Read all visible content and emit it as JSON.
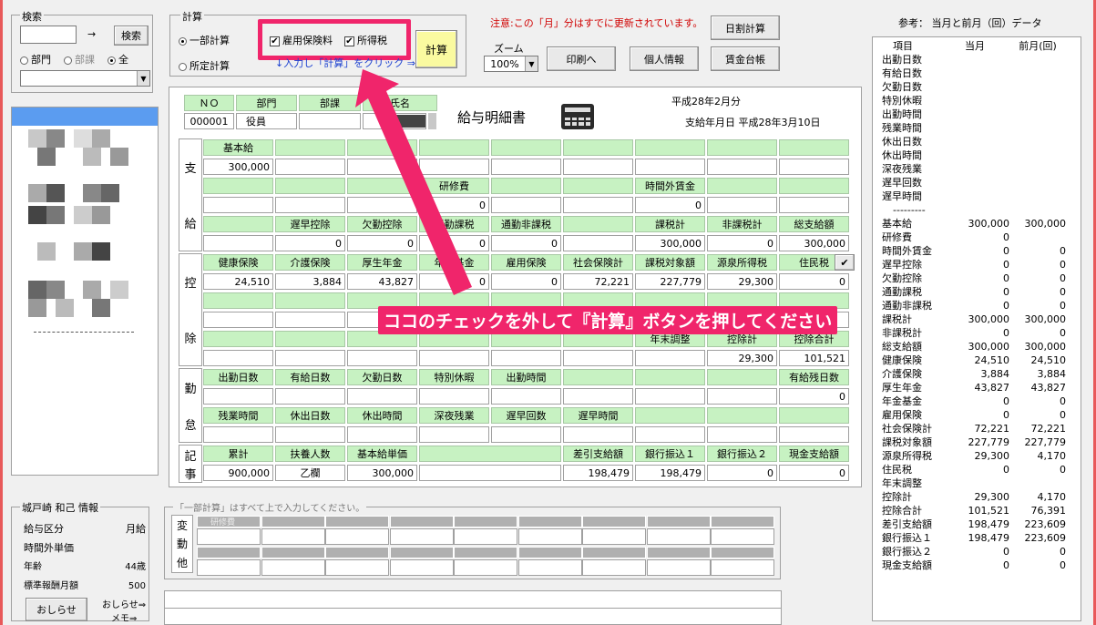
{
  "search": {
    "title": "検索",
    "value": "",
    "button": "検索",
    "arrow": "→",
    "radios": [
      "部門",
      "部課",
      "全"
    ],
    "selected": "全"
  },
  "calc": {
    "title": "計算",
    "partial_label": "一部計算",
    "fixed_label": "所定計算",
    "chk_insurance": "雇用保険料",
    "chk_tax": "所得税",
    "hint": "↓入力し「計算」をクリック ⇒",
    "calc_button": "計算"
  },
  "notice": "注意:この「月」分はすでに更新されています。",
  "zoom": {
    "label": "ズーム",
    "value": "100%"
  },
  "buttons": {
    "daily": "日割計算",
    "print": "印刷へ",
    "personal": "個人情報",
    "ledger": "賃金台帳"
  },
  "slip": {
    "no_label": "ＮＯ",
    "dept_label": "部門",
    "section_label": "部課",
    "name_label": "氏名",
    "no": "000001",
    "dept": "役員",
    "section": "",
    "name": "",
    "title": "給与明細書",
    "period": "平成28年2月分",
    "pay_date": "支給年月日 平成28年3月10日"
  },
  "shikyu": {
    "label1": "支",
    "label2": "給",
    "r1_h": [
      "基本給",
      "",
      "",
      "",
      "",
      "",
      "",
      "",
      ""
    ],
    "r1_v": [
      "300,000",
      "",
      "",
      "",
      "",
      "",
      "",
      "",
      ""
    ],
    "r2_h": [
      "",
      "",
      "",
      "研修費",
      "",
      "",
      "時間外賃金",
      "",
      ""
    ],
    "r2_v": [
      "",
      "",
      "",
      "0",
      "",
      "",
      "0",
      "",
      ""
    ],
    "r3_h": [
      "",
      "遅早控除",
      "欠勤控除",
      "通勤課税",
      "通勤非課税",
      "",
      "課税計",
      "非課税計",
      "総支給額"
    ],
    "r3_v": [
      "",
      "0",
      "0",
      "0",
      "0",
      "",
      "300,000",
      "0",
      "300,000"
    ]
  },
  "kojo": {
    "label1": "控",
    "label2": "除",
    "r1_h": [
      "健康保険",
      "介護保険",
      "厚生年金",
      "年金基金",
      "雇用保険",
      "社会保険計",
      "課税対象額",
      "源泉所得税",
      "住民税"
    ],
    "r1_v": [
      "24,510",
      "3,884",
      "43,827",
      "0",
      "0",
      "72,221",
      "227,779",
      "29,300",
      "0"
    ],
    "r2_h": [
      "",
      "",
      "",
      "",
      "",
      "",
      "",
      "",
      ""
    ],
    "r2_v": [
      "",
      "",
      "",
      "",
      "",
      "",
      "",
      "",
      ""
    ],
    "r3_h": [
      "",
      "",
      "",
      "",
      "",
      "",
      "年末調整",
      "控除計",
      "控除合計"
    ],
    "r3_v": [
      "",
      "",
      "",
      "",
      "",
      "",
      "",
      "29,300",
      "101,521"
    ]
  },
  "kintai": {
    "label1": "勤",
    "label2": "怠",
    "r1_h": [
      "出勤日数",
      "有給日数",
      "欠勤日数",
      "特別休暇",
      "出勤時間",
      "",
      "",
      "",
      "有給残日数"
    ],
    "r1_v": [
      "",
      "",
      "",
      "",
      "",
      "",
      "",
      "",
      "0"
    ],
    "r2_h": [
      "残業時間",
      "休出日数",
      "休出時間",
      "深夜残業",
      "遅早回数",
      "遅早時間",
      "",
      "",
      ""
    ],
    "r2_v": [
      "",
      "",
      "",
      "",
      "",
      "",
      "",
      "",
      ""
    ]
  },
  "kiji": {
    "label1": "記",
    "label2": "事",
    "r1_h": [
      "累計",
      "扶養人数",
      "基本給単価",
      "",
      "差引支給額",
      "銀行振込１",
      "銀行振込２",
      "現金支給額"
    ],
    "r1_v": [
      "900,000",
      "乙欄",
      "300,000",
      "",
      "198,479",
      "198,479",
      "0",
      "0"
    ]
  },
  "annotation": "ココのチェックを外して『計算』ボタンを押してください",
  "henko": {
    "title": "「一部計算」はすべて上で入力してください。",
    "label1": "変",
    "label2": "動",
    "label3": "他",
    "first_header": "研修費"
  },
  "info": {
    "title": "城戸崎 和己 情報",
    "rows": [
      {
        "k": "給与区分",
        "v": "月給"
      },
      {
        "k": "時間外単価",
        "v": ""
      },
      {
        "k": "年齢",
        "v": "44歳"
      },
      {
        "k": "標準報酬月額",
        "v": "500"
      }
    ],
    "notice_btn": "おしらせ",
    "notice_link": "おしらせ⇒",
    "memo_link": "メモ⇒"
  },
  "ref": {
    "title": "参考： 当月と前月（回）データ",
    "col_item": "項目",
    "col_cur": "当月",
    "col_prev": "前月(回)",
    "sep": "---------",
    "top": [
      "出勤日数",
      "有給日数",
      "欠勤日数",
      "特別休暇",
      "出勤時間",
      "残業時間",
      "休出日数",
      "休出時間",
      "深夜残業",
      "遅早回数",
      "遅早時間"
    ],
    "rows": [
      {
        "n": "基本給",
        "c": "300,000",
        "p": "300,000"
      },
      {
        "n": "研修費",
        "c": "0",
        "p": ""
      },
      {
        "n": "時間外賃金",
        "c": "0",
        "p": "0"
      },
      {
        "n": "遅早控除",
        "c": "0",
        "p": "0"
      },
      {
        "n": "欠勤控除",
        "c": "0",
        "p": "0"
      },
      {
        "n": "通勤課税",
        "c": "0",
        "p": "0"
      },
      {
        "n": "通勤非課税",
        "c": "0",
        "p": "0"
      },
      {
        "n": "課税計",
        "c": "300,000",
        "p": "300,000"
      },
      {
        "n": "非課税計",
        "c": "0",
        "p": "0"
      },
      {
        "n": "総支給額",
        "c": "300,000",
        "p": "300,000"
      },
      {
        "n": "健康保険",
        "c": "24,510",
        "p": "24,510"
      },
      {
        "n": "介護保険",
        "c": "3,884",
        "p": "3,884"
      },
      {
        "n": "厚生年金",
        "c": "43,827",
        "p": "43,827"
      },
      {
        "n": "年金基金",
        "c": "0",
        "p": "0"
      },
      {
        "n": "雇用保険",
        "c": "0",
        "p": "0"
      },
      {
        "n": "社会保険計",
        "c": "72,221",
        "p": "72,221"
      },
      {
        "n": "課税対象額",
        "c": "227,779",
        "p": "227,779"
      },
      {
        "n": "源泉所得税",
        "c": "29,300",
        "p": "4,170"
      },
      {
        "n": "住民税",
        "c": "0",
        "p": "0"
      },
      {
        "n": "年末調整",
        "c": "",
        "p": ""
      },
      {
        "n": "控除計",
        "c": "29,300",
        "p": "4,170"
      },
      {
        "n": "控除合計",
        "c": "101,521",
        "p": "76,391"
      },
      {
        "n": "差引支給額",
        "c": "198,479",
        "p": "223,609"
      },
      {
        "n": "銀行振込１",
        "c": "198,479",
        "p": "223,609"
      },
      {
        "n": "銀行振込２",
        "c": "0",
        "p": "0"
      },
      {
        "n": "現金支給額",
        "c": "0",
        "p": "0"
      }
    ]
  },
  "colors": {
    "accent": "#f0256b",
    "header_green": "#c7f2c2",
    "notice_red": "#d00000"
  }
}
